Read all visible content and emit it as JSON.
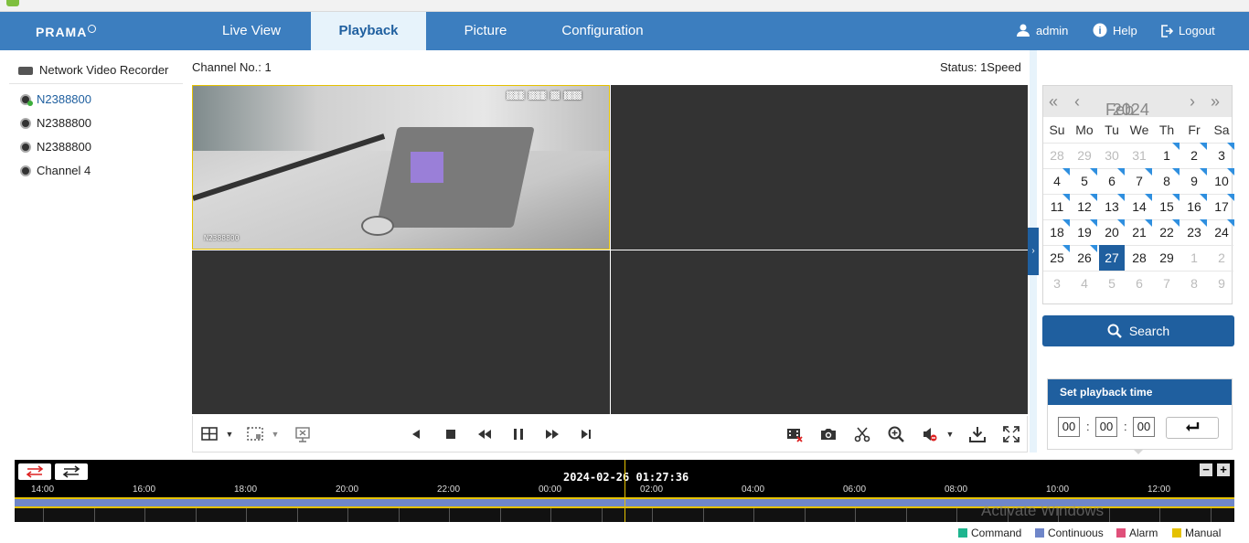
{
  "brand": {
    "logo_text": "PRAMA"
  },
  "nav": {
    "tabs": [
      {
        "label": "Live View",
        "active": false
      },
      {
        "label": "Playback",
        "active": true
      },
      {
        "label": "Picture",
        "active": false
      },
      {
        "label": "Configuration",
        "active": false
      }
    ],
    "user": "admin",
    "help": "Help",
    "logout": "Logout"
  },
  "tree": {
    "root": "Network Video Recorder",
    "items": [
      "N2388800",
      "N2388800",
      "N2388800",
      "Channel 4"
    ],
    "active_index": 0
  },
  "view": {
    "channel_label": "Channel No.: 1",
    "status_label": "Status: 1Speed",
    "osd_name": "N2388800"
  },
  "calendar": {
    "month": "Feb",
    "year": "2024",
    "weekdays": [
      "Su",
      "Mo",
      "Tu",
      "We",
      "Th",
      "Fr",
      "Sa"
    ],
    "weeks": [
      [
        "28",
        "29",
        "30",
        "31",
        "1",
        "2",
        "3"
      ],
      [
        "4",
        "5",
        "6",
        "7",
        "8",
        "9",
        "10"
      ],
      [
        "11",
        "12",
        "13",
        "14",
        "15",
        "16",
        "17"
      ],
      [
        "18",
        "19",
        "20",
        "21",
        "22",
        "23",
        "24"
      ],
      [
        "25",
        "26",
        "27",
        "28",
        "29",
        "1",
        "2"
      ],
      [
        "3",
        "4",
        "5",
        "6",
        "7",
        "8",
        "9"
      ]
    ],
    "selected": "27"
  },
  "search": {
    "label": "Search"
  },
  "playback_time": {
    "title": "Set playback time",
    "hh": "00",
    "mm": "00",
    "ss": "00"
  },
  "timeline": {
    "current": "2024-02-26 01:27:36",
    "ticks": [
      "14:00",
      "16:00",
      "18:00",
      "20:00",
      "22:00",
      "00:00",
      "02:00",
      "04:00",
      "06:00",
      "08:00",
      "10:00",
      "12:00"
    ]
  },
  "legend": [
    {
      "label": "Command",
      "color": "#1fb58f"
    },
    {
      "label": "Continuous",
      "color": "#6f86c9"
    },
    {
      "label": "Alarm",
      "color": "#e0507a"
    },
    {
      "label": "Manual",
      "color": "#e5c100"
    }
  ],
  "watermark": "Activate Windows",
  "colors": {
    "nav": "#3c7ebf",
    "accent": "#1f5f9f",
    "selection": "#e5c100"
  }
}
